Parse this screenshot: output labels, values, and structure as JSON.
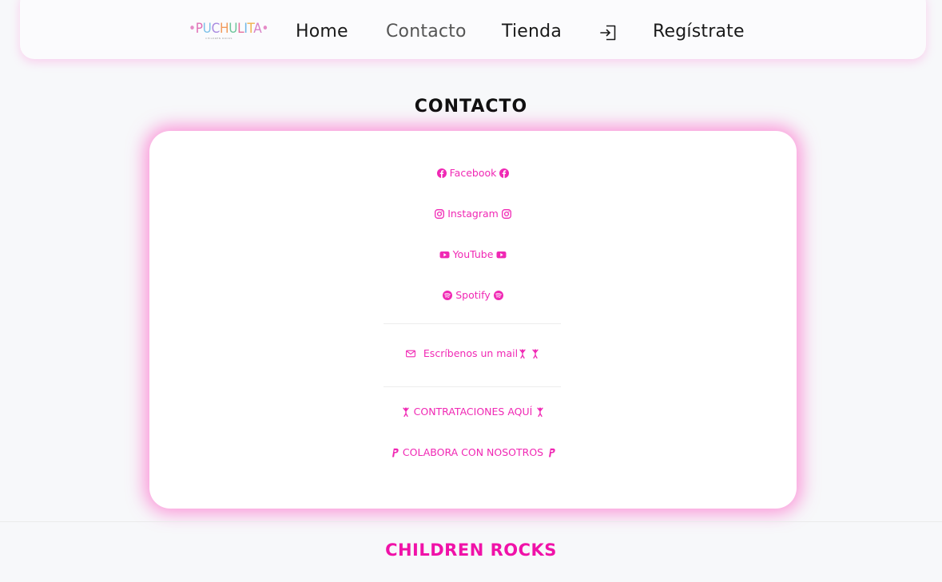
{
  "nav": {
    "logo_text": "PUCHULITA",
    "logo_tagline": "CHILDREN ROCKS",
    "links": [
      "Home",
      "Contacto",
      "Tienda"
    ],
    "login_icon": "login-arrow-icon",
    "register": "Regístrate"
  },
  "page": {
    "title": "CONTACTO"
  },
  "contact": {
    "facebook": "Facebook",
    "instagram": "Instagram",
    "youtube": "YouTube",
    "spotify": "Spotify",
    "email": "Escríbenos un mail",
    "hire": "CONTRATACIONES AQUÍ",
    "collab": "COLABORA CON NOSOTROS"
  },
  "footer": {
    "title": "CHILDREN ROCKS"
  },
  "colors": {
    "accent": "#f028b4",
    "footer_accent": "#f012a8",
    "glow": "#ff46be",
    "background": "#f7f8fa"
  }
}
